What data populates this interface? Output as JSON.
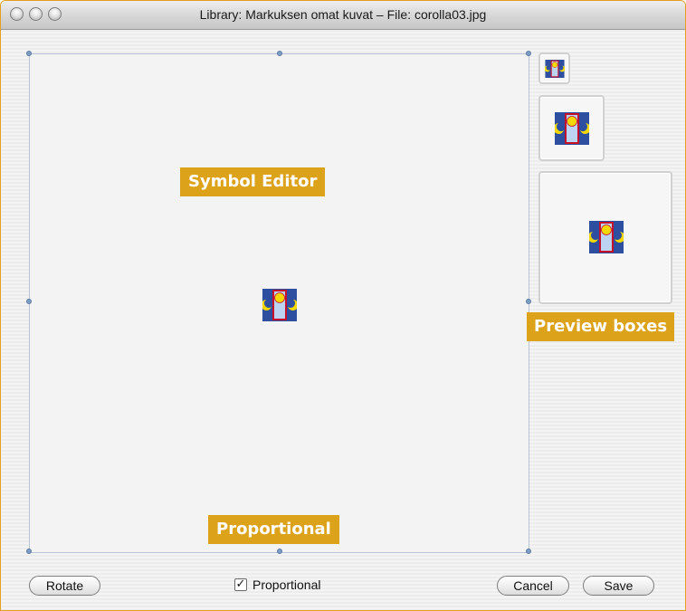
{
  "window": {
    "title": "Library: Markuksen omat kuvat – File: corolla03.jpg",
    "buttons": [
      "close-button",
      "minimize-button",
      "zoom-button"
    ]
  },
  "annotations": {
    "symbol_editor": "Symbol Editor",
    "preview_boxes": "Preview boxes",
    "proportional": "Proportional"
  },
  "symbol": {
    "name": "corolla03-icon",
    "colors": {
      "background": "#2e4fa0",
      "frame": "#c4102a",
      "window": "#bcd4f2",
      "sun": "#f5d800",
      "moons": "#f5d800"
    }
  },
  "previews": [
    {
      "name": "preview-small"
    },
    {
      "name": "preview-medium"
    },
    {
      "name": "preview-large"
    }
  ],
  "footer": {
    "rotate_label": "Rotate",
    "proportional_label": "Proportional",
    "proportional_checked": true,
    "cancel_label": "Cancel",
    "save_label": "Save"
  }
}
